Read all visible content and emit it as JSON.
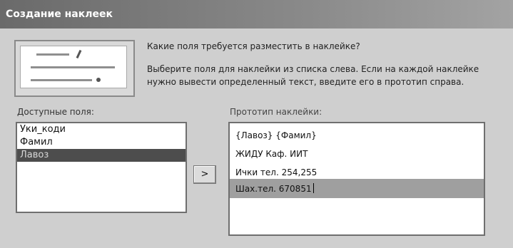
{
  "window": {
    "title": "Создание наклеек"
  },
  "wizard": {
    "question": "Какие поля требуется разместить в наклейке?",
    "hint_line1": "Выберите поля для наклейки из списка слева. Если на каждой наклейке",
    "hint_line2": "нужно вывести определенный текст, введите его в прототип справа."
  },
  "available_fields": {
    "label": "Доступные поля:",
    "items": [
      "Уки_коди",
      "Фамил",
      "Лавоз"
    ],
    "selected_index": 2
  },
  "add_button": {
    "label": ">"
  },
  "prototype": {
    "label": "Прототип наклейки:",
    "lines": [
      "{Лавоз} {Фамил}",
      "ЖИДУ Каф. ИИТ",
      "Ички тел. 254,255",
      "Шах.тел. 670851"
    ],
    "active_line_index": 3
  }
}
